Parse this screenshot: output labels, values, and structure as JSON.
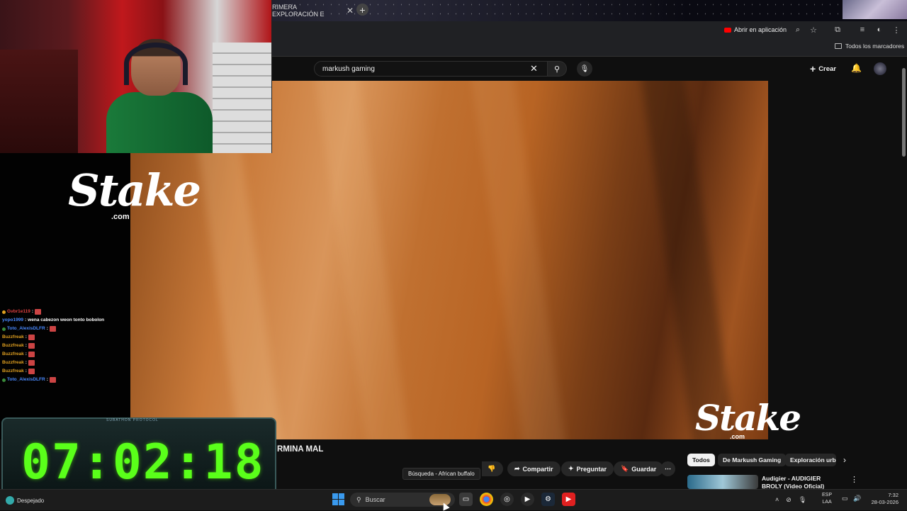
{
  "browser": {
    "tab_title": "RIMERA EXPLORACIÓN E",
    "open_in_app": "Abrir en aplicación",
    "all_bookmarks": "Todos los marcadores"
  },
  "youtube": {
    "search_value": "markush gaming",
    "create_label": "Crear",
    "video_title": "RMINA MAL",
    "actions": {
      "share": "Compartir",
      "ask": "Preguntar",
      "save": "Guardar"
    },
    "tooltip": "Búsqueda - African buffalo",
    "chips": [
      "Todos",
      "De Markush Gaming",
      "Exploración urba"
    ],
    "recommended": {
      "title": "Audigier - AUDIGIER BROLY (Video Oficial)"
    }
  },
  "overlay": {
    "brand": "Stake",
    "brand_suffix": ".com",
    "timer_title": "SUBATHON PROTOCOL",
    "timer": "07:02:18"
  },
  "chat": [
    {
      "user": "Gvbr1e119",
      "message": "",
      "color": "#e04040",
      "badge": true
    },
    {
      "user": "yopo1999",
      "message": "wena cabezon weon tonto bobolon",
      "color": "#4a8aff",
      "badge": false
    },
    {
      "user": "Toto_AlexisDLFR",
      "message": "",
      "color": "#4a8aff",
      "badge": true
    },
    {
      "user": "Buzzfreak",
      "message": "",
      "color": "#e0a020",
      "badge": false
    },
    {
      "user": "Buzzfreak",
      "message": "",
      "color": "#e0a020",
      "badge": false
    },
    {
      "user": "Buzzfreak",
      "message": "",
      "color": "#e0a020",
      "badge": false
    },
    {
      "user": "Buzzfreak",
      "message": "",
      "color": "#e0a020",
      "badge": false
    },
    {
      "user": "Buzzfreak",
      "message": "",
      "color": "#e0a020",
      "badge": false
    },
    {
      "user": "Toto_AlexisDLFR",
      "message": "",
      "color": "#4a8aff",
      "badge": true
    }
  ],
  "taskbar": {
    "weather": "Despejado",
    "search_placeholder": "Buscar",
    "lang_1": "ESP",
    "lang_2": "LAA",
    "time": "7:32",
    "date": "28-03-2026"
  },
  "colors": {
    "timer_green": "#5aff1a",
    "yt_red": "#ff0000"
  }
}
